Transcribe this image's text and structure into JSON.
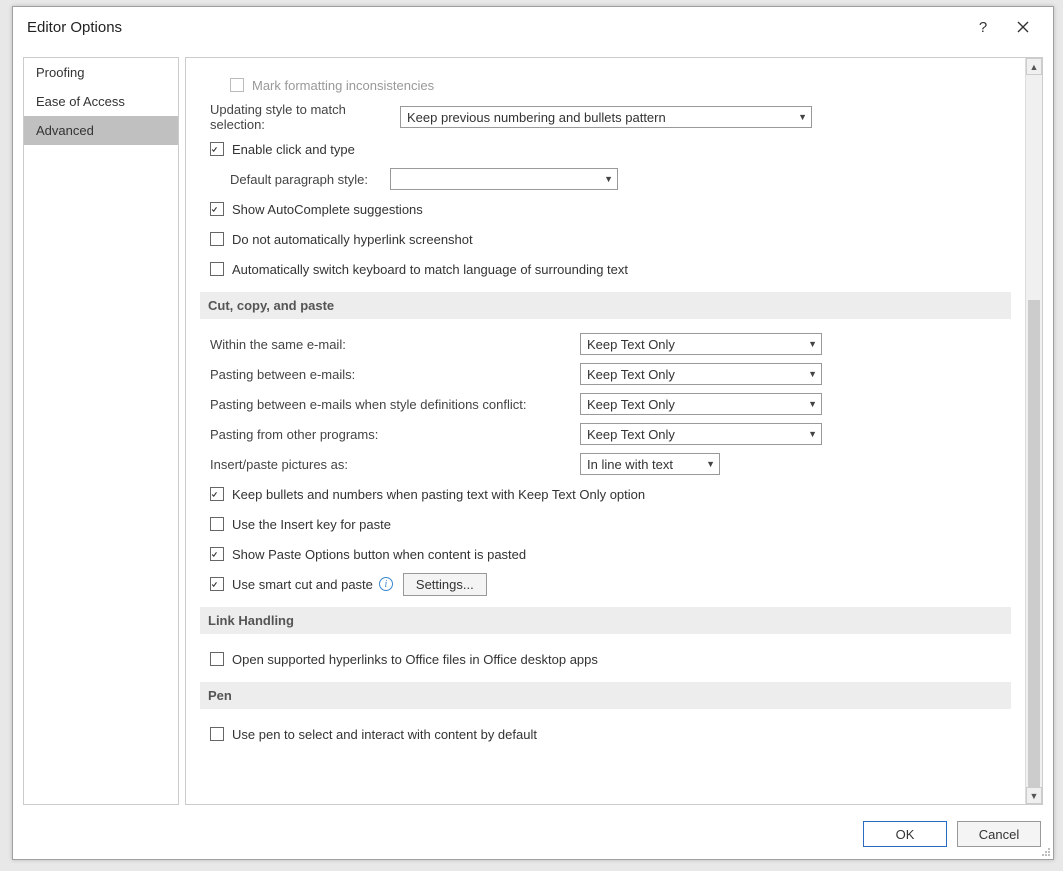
{
  "dialog": {
    "title": "Editor Options"
  },
  "nav": {
    "items": [
      {
        "label": "Proofing",
        "selected": false
      },
      {
        "label": "Ease of Access",
        "selected": false
      },
      {
        "label": "Advanced",
        "selected": true
      }
    ]
  },
  "editing": {
    "mark_formatting": "Mark formatting inconsistencies",
    "updating_style_label": "Updating style to match selection:",
    "updating_style_value": "Keep previous numbering and bullets pattern",
    "enable_click_type": "Enable click and type",
    "default_para_label": "Default paragraph style:",
    "default_para_value": "",
    "show_autocomplete": "Show AutoComplete suggestions",
    "no_auto_hyperlink": "Do not automatically hyperlink screenshot",
    "auto_keyboard": "Automatically switch keyboard to match language of surrounding text"
  },
  "cutcopy": {
    "header": "Cut, copy, and paste",
    "within_label": "Within the same e-mail:",
    "within_value": "Keep Text Only",
    "between_label": "Pasting between e-mails:",
    "between_value": "Keep Text Only",
    "conflict_label": "Pasting between e-mails when style definitions conflict:",
    "conflict_value": "Keep Text Only",
    "other_label": "Pasting from other programs:",
    "other_value": "Keep Text Only",
    "pictures_label": "Insert/paste pictures as:",
    "pictures_value": "In line with text",
    "keep_bullets": "Keep bullets and numbers when pasting text with Keep Text Only option",
    "insert_key": "Use the Insert key for paste",
    "paste_options": "Show Paste Options button when content is pasted",
    "smart_cut": "Use smart cut and paste",
    "settings_btn": "Settings..."
  },
  "linkhandling": {
    "header": "Link Handling",
    "open_supported": "Open supported hyperlinks to Office files in Office desktop apps"
  },
  "pen": {
    "header": "Pen",
    "use_pen": "Use pen to select and interact with content by default"
  },
  "footer": {
    "ok": "OK",
    "cancel": "Cancel"
  }
}
